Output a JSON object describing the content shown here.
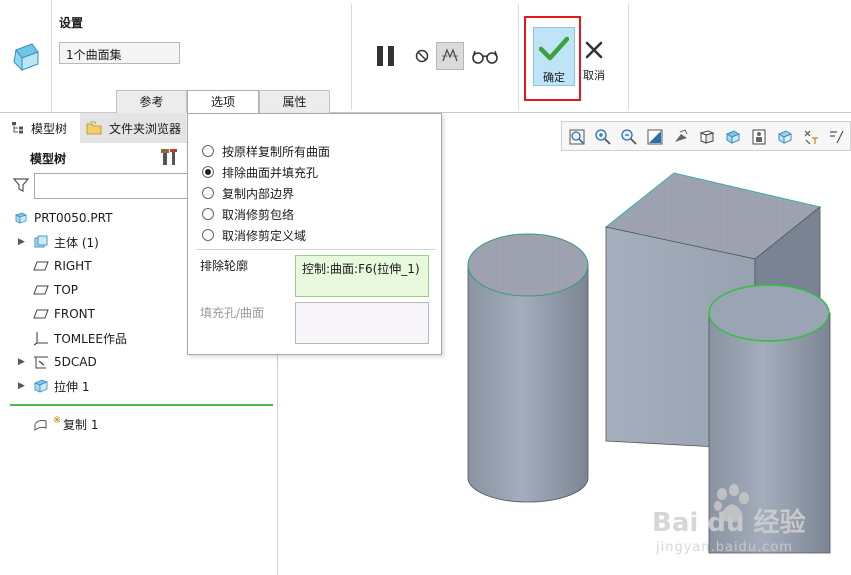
{
  "dashboard": {
    "settings_title": "设置",
    "selector_value": "1个曲面集",
    "tabs": [
      {
        "label": "参考",
        "active": false
      },
      {
        "label": "选项",
        "active": true
      },
      {
        "label": "属性",
        "active": false
      }
    ],
    "tools": {
      "pause_icon": "pause-icon",
      "no_preview_icon": "no-preview-icon",
      "verify_icon": "verify-preview-icon",
      "glasses_icon": "glasses-icon"
    },
    "ok_label": "确定",
    "cancel_label": "取消"
  },
  "navigator": {
    "tabs": [
      {
        "label": "模型树",
        "icon": "model-tree-icon",
        "active": true
      },
      {
        "label": "文件夹浏览器",
        "icon": "folder-browser-icon",
        "active": false
      }
    ],
    "title": "模型树",
    "filter_value": "",
    "tree": [
      {
        "label": "PRT0050.PRT",
        "icon": "part-icon",
        "expandable": false
      },
      {
        "label": "主体 (1)",
        "icon": "body-icon",
        "expandable": true
      },
      {
        "label": "RIGHT",
        "icon": "datum-plane-icon",
        "expandable": false
      },
      {
        "label": "TOP",
        "icon": "datum-plane-icon",
        "expandable": false
      },
      {
        "label": "FRONT",
        "icon": "datum-plane-icon",
        "expandable": false
      },
      {
        "label": "TOMLEE作品",
        "icon": "coordinate-system-icon",
        "expandable": false
      },
      {
        "label": "5DCAD",
        "icon": "sketch-icon",
        "expandable": true
      },
      {
        "label": "拉伸 1",
        "icon": "extrude-icon",
        "expandable": true
      },
      {
        "label": "复制 1",
        "icon": "copy-surface-icon",
        "expandable": false,
        "marker": "※"
      }
    ]
  },
  "options_panel": {
    "radio_options": [
      {
        "label": "按原样复制所有曲面",
        "checked": false
      },
      {
        "label": "排除曲面并填充孔",
        "checked": true
      },
      {
        "label": "复制内部边界",
        "checked": false
      },
      {
        "label": "取消修剪包络",
        "checked": false
      },
      {
        "label": "取消修剪定义域",
        "checked": false
      }
    ],
    "exclude_label": "排除轮廓",
    "exclude_value": "控制:曲面:F6(拉伸_1)",
    "fill_label": "填充孔/曲面",
    "fill_value": ""
  },
  "view_toolbar": [
    "refit-icon",
    "zoom-in-icon",
    "zoom-out-icon",
    "repaint-icon",
    "display-style-icon",
    "saved-orientations-icon",
    "view-manager-icon",
    "perspective-icon",
    "datum-display-icon",
    "spin-center-icon",
    "annotation-display-icon"
  ],
  "watermark": {
    "brand": "Bai du 经验",
    "url": "jingyan.baidu.com"
  },
  "colors": {
    "ok_fill": "#bfe4f8",
    "ok_check": "#3aa43a",
    "highlight": "#e11b1b",
    "collector_active": "#e8fadd",
    "model_gray": "#9aa4b4"
  }
}
